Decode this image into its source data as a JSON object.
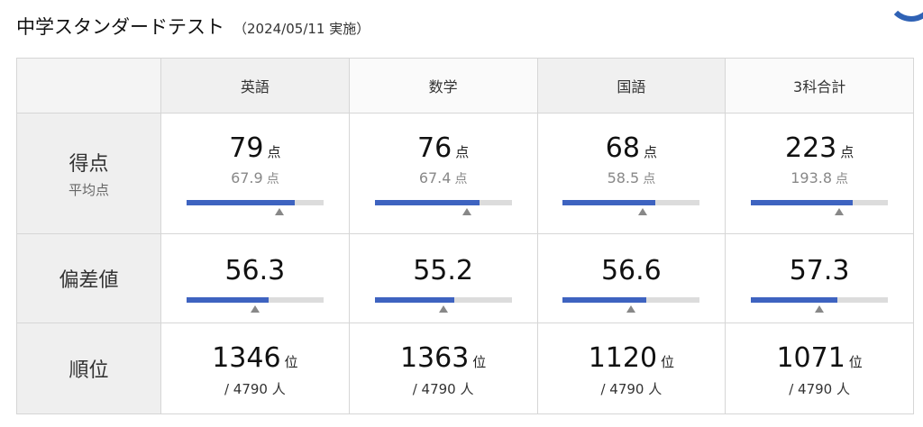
{
  "header": {
    "title": "中学スタンダードテスト",
    "date": "（2024/05/11 実施）"
  },
  "columns": [
    "英語",
    "数学",
    "国語",
    "3科合計"
  ],
  "rows": {
    "score_label": "得点",
    "score_sublabel": "平均点",
    "deviation_label": "偏差値",
    "rank_label": "順位"
  },
  "units": {
    "point": "点",
    "rank": "位",
    "people": "人"
  },
  "subjects": [
    {
      "name": "英語",
      "score": "79",
      "average": "67.9",
      "score_ratio": 0.79,
      "avg_ratio": 0.679,
      "deviation": "56.3",
      "dev_ratio": 0.6,
      "dev_marker": 0.5,
      "rank": "1346",
      "total": "/ 4790"
    },
    {
      "name": "数学",
      "score": "76",
      "average": "67.4",
      "score_ratio": 0.76,
      "avg_ratio": 0.674,
      "deviation": "55.2",
      "dev_ratio": 0.58,
      "dev_marker": 0.5,
      "rank": "1363",
      "total": "/ 4790"
    },
    {
      "name": "国語",
      "score": "68",
      "average": "58.5",
      "score_ratio": 0.68,
      "avg_ratio": 0.585,
      "deviation": "56.6",
      "dev_ratio": 0.61,
      "dev_marker": 0.5,
      "rank": "1120",
      "total": "/ 4790"
    },
    {
      "name": "3科合計",
      "score": "223",
      "average": "193.8",
      "score_ratio": 0.743,
      "avg_ratio": 0.646,
      "deviation": "57.3",
      "dev_ratio": 0.63,
      "dev_marker": 0.5,
      "rank": "1071",
      "total": "/ 4790"
    }
  ],
  "colors": {
    "bar_fill": "#3e63c0",
    "bar_track": "#dcdcdc",
    "marker": "#888888"
  }
}
